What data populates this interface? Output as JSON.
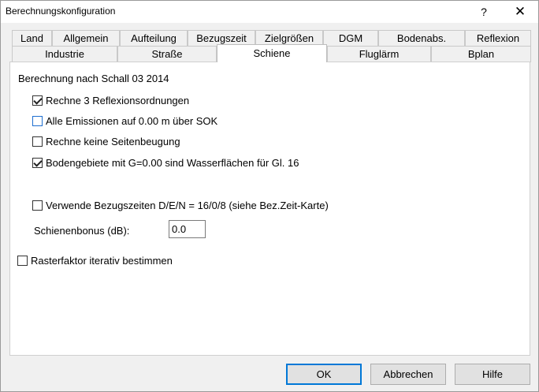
{
  "window": {
    "title": "Berechnungskonfiguration",
    "help_glyph": "?",
    "close_glyph": "✕"
  },
  "tabs_top": [
    "Land",
    "Allgemein",
    "Aufteilung",
    "Bezugszeit",
    "Zielgrößen",
    "DGM",
    "Bodenabs.",
    "Reflexion"
  ],
  "tabs_bottom": [
    "Industrie",
    "Straße",
    "Schiene",
    "Fluglärm",
    "Bplan"
  ],
  "active_tab": "Schiene",
  "panel": {
    "section_title": "Berechnung nach Schall 03 2014",
    "options": [
      {
        "label": "Rechne 3 Reflexionsordnungen",
        "checked": true
      },
      {
        "label": "Alle Emissionen auf 0.00 m über SOK",
        "checked": false
      },
      {
        "label": "Rechne keine Seitenbeugung",
        "checked": false
      },
      {
        "label": "Bodengebiete mit G=0.00 sind Wasserflächen für Gl. 16",
        "checked": true
      },
      {
        "label": "Verwende Bezugszeiten D/E/N = 16/0/8 (siehe Bez.Zeit-Karte)",
        "checked": false
      }
    ],
    "bonus_label": "Schienenbonus (dB):",
    "bonus_value": "0.0",
    "raster_label": "Rasterfaktor iterativ bestimmen",
    "raster_checked": false
  },
  "buttons": {
    "ok": "OK",
    "cancel": "Abbrechen",
    "help": "Hilfe"
  }
}
